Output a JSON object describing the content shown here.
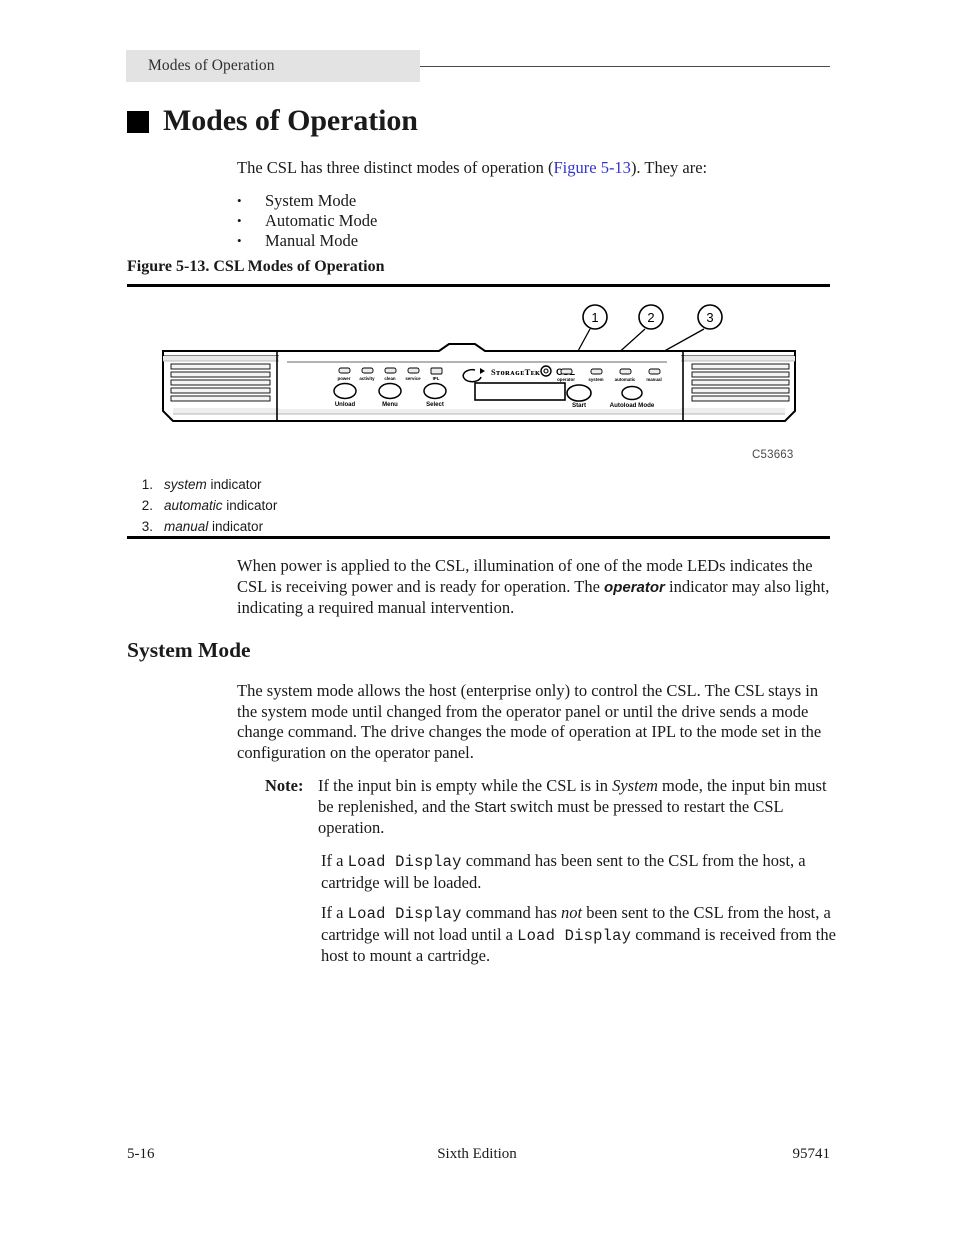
{
  "header": {
    "running_title": "Modes of Operation"
  },
  "heading": {
    "h1": "Modes of Operation",
    "h2": "System Mode"
  },
  "intro": {
    "before_link": "The CSL has three distinct modes of operation (",
    "link": "Figure 5-13",
    "after_link": "). They are:"
  },
  "bullets": [
    {
      "marker": "•",
      "label": "System Mode"
    },
    {
      "marker": "•",
      "label": "Automatic Mode"
    },
    {
      "marker": "•",
      "label": "Manual Mode"
    }
  ],
  "figure": {
    "caption": "Figure 5-13. CSL Modes of Operation",
    "art_id": "C53663",
    "callouts": [
      "1",
      "2",
      "3"
    ],
    "panel": {
      "brand": "StorageTek",
      "product": "CSL",
      "left_leds": [
        "power",
        "activity",
        "clean",
        "service",
        "IPL"
      ],
      "left_buttons": [
        "Unload",
        "Menu",
        "Select"
      ],
      "right_leds": [
        "operator",
        "system",
        "automatic",
        "manual"
      ],
      "right_buttons": [
        "Start",
        "Autoload Mode"
      ]
    },
    "legend": [
      {
        "num": "1.",
        "term": "system",
        "rest": " indicator"
      },
      {
        "num": "2.",
        "term": "automatic",
        "rest": " indicator"
      },
      {
        "num": "3.",
        "term": "manual",
        "rest": " indicator"
      }
    ]
  },
  "body": {
    "power_paragraph_a": "When power is applied to the CSL, illumination of one of the mode LEDs indicates the CSL is receiving power and is ready for operation. The ",
    "power_emphasis": "operator",
    "power_paragraph_b": " indicator may also light, indicating a required manual intervention.",
    "system_paragraph": "The system mode allows the host (enterprise only) to control the CSL. The CSL stays in the system mode until changed from the operator panel or until the drive sends a mode change command. The drive changes the mode of operation at IPL to the mode set in the configuration on the operator panel.",
    "note_label": "Note:",
    "note_a": "If the input bin is empty while the CSL is in ",
    "note_italic": "System",
    "note_b": " mode, the input bin must be replenished, and the ",
    "note_bold": "Start",
    "note_c": " switch must be pressed to restart the CSL operation.",
    "load1_a": "If a ",
    "load1_cmd": "Load Display",
    "load1_b": " command has been sent to the CSL from the host, a cartridge will be loaded.",
    "load2_a": "If a ",
    "load2_cmd1": "Load Display",
    "load2_b": " command has ",
    "load2_not": "not",
    "load2_c": " been sent to the CSL from the host, a cartridge will not load until a ",
    "load2_cmd2": "Load Display",
    "load2_d": " command is received from the host to mount a cartridge."
  },
  "footer": {
    "page_number": "5-16",
    "edition": "Sixth Edition",
    "doc_number": "95741"
  },
  "colors": {
    "link": "#3333CC",
    "header_band": "#E3E3E3",
    "rule": "#000000"
  }
}
